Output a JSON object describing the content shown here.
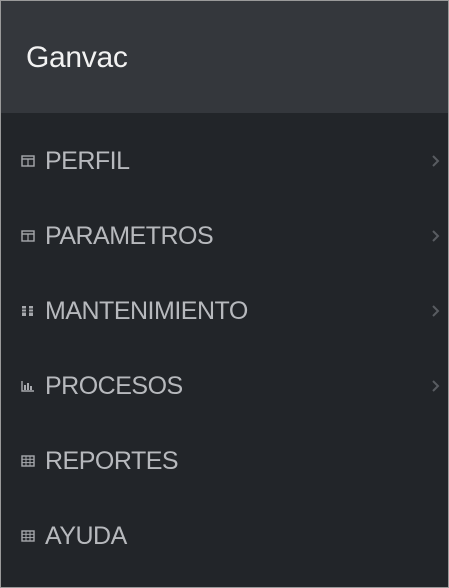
{
  "app": {
    "brand": "Ganvac"
  },
  "menu": {
    "items": [
      {
        "label": "PERFIL",
        "icon": "table-icon",
        "has_submenu": true
      },
      {
        "label": "PARAMETROS",
        "icon": "table-icon",
        "has_submenu": true
      },
      {
        "label": "MANTENIMIENTO",
        "icon": "columns-icon",
        "has_submenu": true
      },
      {
        "label": "PROCESOS",
        "icon": "chart-icon",
        "has_submenu": true
      },
      {
        "label": "REPORTES",
        "icon": "grid-icon",
        "has_submenu": false
      },
      {
        "label": "AYUDA",
        "icon": "grid-icon",
        "has_submenu": false
      }
    ]
  },
  "colors": {
    "sidebar_bg": "#222529",
    "header_bg": "#34373c",
    "text": "#b7b9bd",
    "brand_text": "#f2f2f2"
  }
}
